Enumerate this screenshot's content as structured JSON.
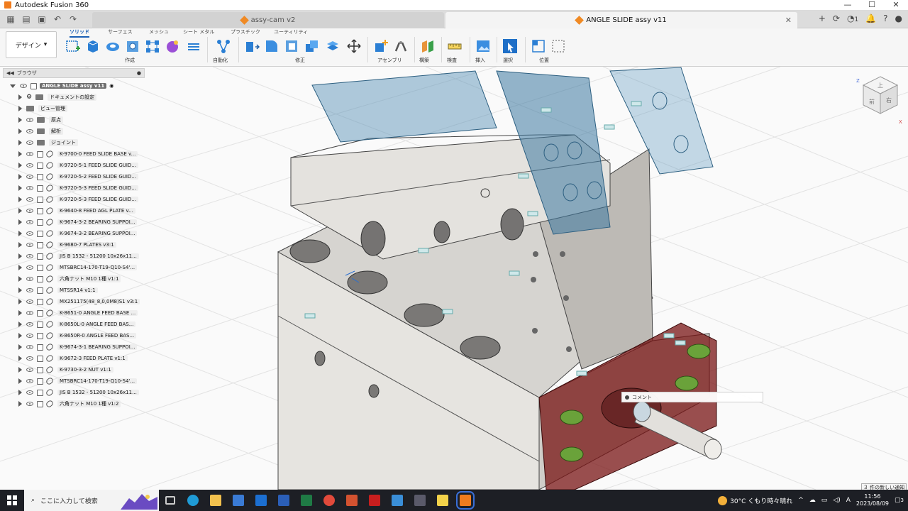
{
  "window": {
    "title": "Autodesk Fusion 360",
    "controls": {
      "minimize": "—",
      "maximize": "☐",
      "close": "✕"
    }
  },
  "tabs": {
    "inactive": {
      "label": "assy-cam v2"
    },
    "active": {
      "label": "ANGLE SLIDE assy v11"
    },
    "notification_count": "1"
  },
  "ribbon": {
    "workspace": "デザイン",
    "tabs": [
      "ソリッド",
      "サーフェス",
      "メッシュ",
      "シート メタル",
      "プラスチック",
      "ユーティリティ"
    ],
    "groups": [
      "作成",
      "自動化",
      "修正",
      "アセンブリ",
      "構築",
      "検査",
      "挿入",
      "選択",
      "位置"
    ]
  },
  "browser": {
    "title": "ブラウザ",
    "root": "ANGLE SLIDE assy v11",
    "folders": [
      "ドキュメントの設定",
      "ビュー管理",
      "原点",
      "解析",
      "ジョイント"
    ],
    "components": [
      "K-9700-0 FEED SLIDE BASE v...",
      "K-9720-5-1 FEED SLIDE GUID...",
      "K-9720-5-2 FEED SLIDE GUID...",
      "K-9720-5-3 FEED SLIDE GUID...",
      "K-9720-5-3 FEED SLIDE GUID...",
      "K-9640-8 FEED AGL PLATE v...",
      "K-9674-3-2 BEARING SUPPOI...",
      "K-9674-3-2 BEARING SUPPOI...",
      "K-9680-7 PLATES v3:1",
      "JIS B 1532 - 51200 10x26x11...",
      "MTSBRC14-170-T19-Q10-S4'...",
      "六角ナット M10 1種 v1:1",
      "MTSSR14 v1:1",
      "MX251175(48_8,0,0M8)S1 v3:1",
      "K-8651-0 ANGLE FEED BASE ...",
      "K-8650L-0 ANGLE FEED BAS...",
      "K-8650R-0 ANGLE FEED BAS...",
      "K-9674-3-1 BEARING SUPPOI...",
      "K-9672-3 FEED PLATE v1:1",
      "K-9730-3-2 NUT v1:1",
      "MTSBRC14-170-T19-Q10-S4'...",
      "JIS B 1532 - 51200 10x26x11...",
      "六角ナット M10 1種 v1:2"
    ]
  },
  "viewcube": {
    "top": "上",
    "front": "前",
    "right": "右"
  },
  "comment": {
    "label": "コメント"
  },
  "notification": "３ 件の新しい通知",
  "taskbar": {
    "search_placeholder": "ここに入力して検索",
    "weather": "30°C くもり時々晴れ",
    "ime": "A",
    "time": "11:56",
    "date": "2023/08/09",
    "notif_count": "3"
  }
}
